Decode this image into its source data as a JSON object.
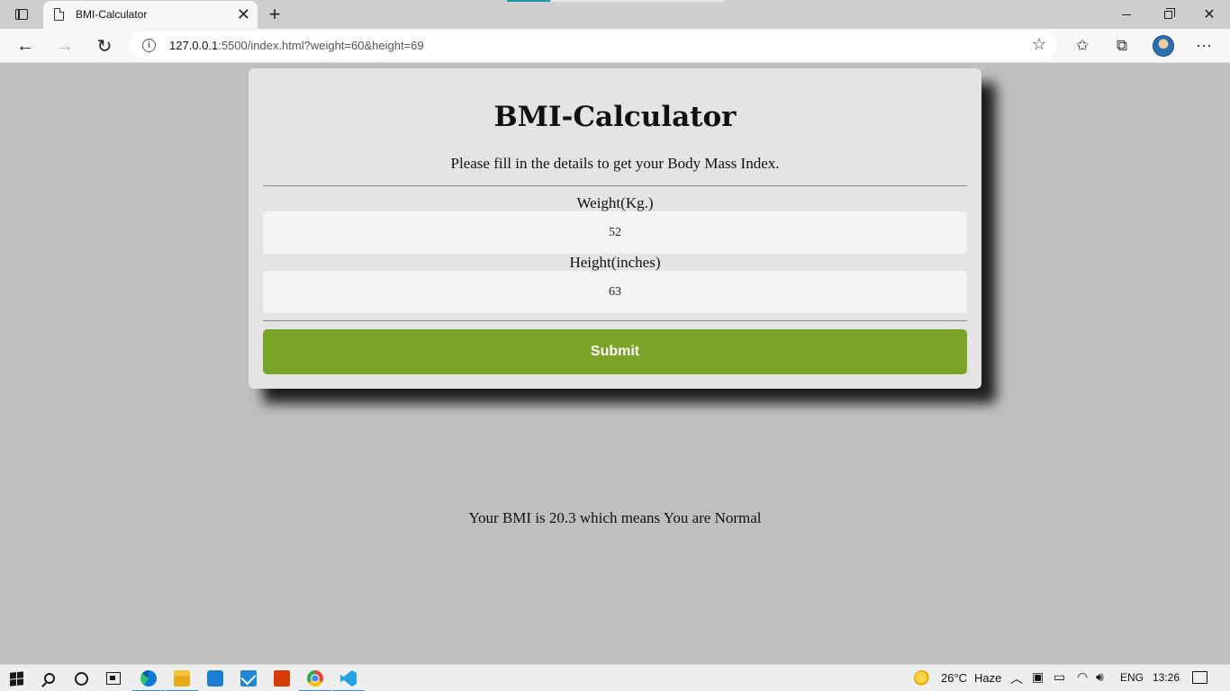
{
  "browser": {
    "tab": {
      "title": "BMI-Calculator",
      "close_glyph": "✕"
    },
    "new_tab_glyph": "+",
    "url_host": "127.0.0.1",
    "url_rest": ":5500/index.html?weight=60&height=69",
    "back_glyph": "←",
    "forward_glyph": "→",
    "refresh_glyph": "↻",
    "info_glyph": "i",
    "favorite_glyph": "☆",
    "favorites_glyph": "✩",
    "collections_glyph": "⧉",
    "menu_glyph": "⋯",
    "window_close_glyph": "✕",
    "accent_color": "#1d9ba3"
  },
  "page": {
    "title": "BMI-Calculator",
    "subtitle": "Please fill in the details to get your Body Mass Index.",
    "weight_label": "Weight(Kg.)",
    "weight_value": "52",
    "height_label": "Height(inches)",
    "height_value": "63",
    "submit_label": "Submit",
    "result_text": "Your BMI is 20.3 which means You are Normal",
    "submit_color": "#7aa428"
  },
  "taskbar": {
    "weather": "26°C",
    "weather_desc": "Haze",
    "language": "ENG",
    "time": "13:26",
    "chevron_glyph": "︿",
    "battery_glyph": "▭",
    "wifi_glyph": "◠",
    "volume_glyph": "🔊︎",
    "meet_glyph": "▣",
    "apps": [
      "edge-icon",
      "file-explorer-icon",
      "store-icon",
      "mail-icon",
      "office-icon",
      "chrome-icon",
      "vscode-icon"
    ]
  }
}
